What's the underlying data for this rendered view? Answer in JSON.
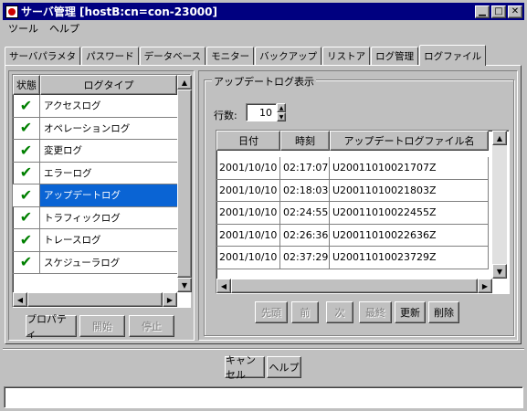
{
  "window": {
    "title": "サーバ管理 [hostB:cn=con-23000]"
  },
  "menu": [
    "ツール",
    "ヘルプ"
  ],
  "tabs": [
    {
      "label": "サーバパラメタ"
    },
    {
      "label": "パスワード"
    },
    {
      "label": "データベース"
    },
    {
      "label": "モニター"
    },
    {
      "label": "バックアップ"
    },
    {
      "label": "リストア"
    },
    {
      "label": "ログ管理"
    },
    {
      "label": "ログファイル",
      "active": true
    }
  ],
  "log_list": {
    "headers": [
      "状態",
      "ログタイプ"
    ],
    "rows": [
      {
        "label": "アクセスログ",
        "checked": true
      },
      {
        "label": "オペレーションログ",
        "checked": true
      },
      {
        "label": "変更ログ",
        "checked": true
      },
      {
        "label": "エラーログ",
        "checked": true
      },
      {
        "label": "アップデートログ",
        "checked": true,
        "selected": true
      },
      {
        "label": "トラフィックログ",
        "checked": true
      },
      {
        "label": "トレースログ",
        "checked": true
      },
      {
        "label": "スケジューラログ",
        "checked": true
      }
    ],
    "check_glyph": "✔"
  },
  "left_buttons": {
    "properties": "プロパティ",
    "start": "開始",
    "stop": "停止"
  },
  "update_log": {
    "group_title": "アップデートログ表示",
    "rows_label": "行数:",
    "rows_value": "10",
    "headers": [
      "日付",
      "時刻",
      "アップデートログファイル名"
    ],
    "rows": [
      [
        "2001/10/10",
        "02:17:07",
        "U20011010021707Z"
      ],
      [
        "2001/10/10",
        "02:18:03",
        "U20011010021803Z"
      ],
      [
        "2001/10/10",
        "02:24:55",
        "U20011010022455Z"
      ],
      [
        "2001/10/10",
        "02:26:36",
        "U20011010022636Z"
      ],
      [
        "2001/10/10",
        "02:37:29",
        "U20011010023729Z"
      ]
    ]
  },
  "nav_buttons": {
    "first": "先頭",
    "prev": "前",
    "next": "次",
    "last": "最終",
    "refresh": "更新",
    "delete": "削除"
  },
  "dialog_buttons": {
    "cancel": "キャンセル",
    "help": "ヘルプ"
  },
  "colors": {
    "titlebar": "#000080",
    "selection": "#0a64d4",
    "check": "#008000"
  }
}
